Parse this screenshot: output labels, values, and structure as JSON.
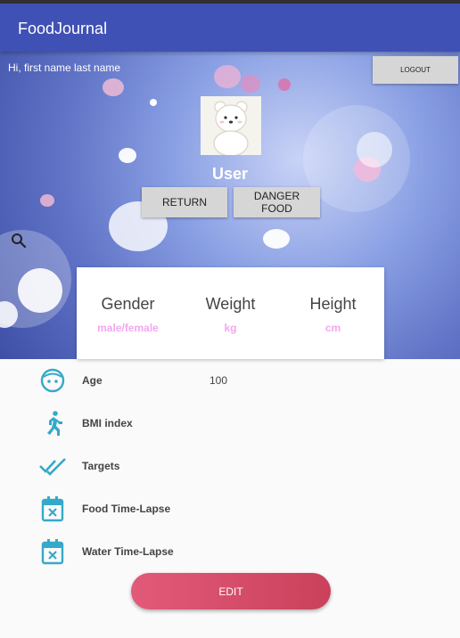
{
  "app": {
    "title": "FoodJournal"
  },
  "header": {
    "greeting": "Hi, first name last name",
    "logout_label": "LOGOUT",
    "username": "User",
    "return_label": "RETURN",
    "danger_food_label": "DANGER FOOD"
  },
  "stats": [
    {
      "label": "Gender",
      "unit": "male/female"
    },
    {
      "label": "Weight",
      "unit": "kg"
    },
    {
      "label": "Height",
      "unit": "cm"
    }
  ],
  "details": [
    {
      "label": "Age",
      "value": "100",
      "icon": "face-icon"
    },
    {
      "label": "BMI index",
      "value": "",
      "icon": "running-icon"
    },
    {
      "label": "Targets",
      "value": "",
      "icon": "double-check-icon"
    },
    {
      "label": "Food Time-Lapse",
      "value": "",
      "icon": "calendar-cancel-icon"
    },
    {
      "label": "Water Time-Lapse",
      "value": "",
      "icon": "calendar-cancel-icon"
    }
  ],
  "edit_label": "EDIT",
  "colors": {
    "primary": "#3f51b5",
    "accent_icon": "#35a9c9",
    "unit_text": "#f3a6f0",
    "edit_button": "#d94f6c"
  }
}
